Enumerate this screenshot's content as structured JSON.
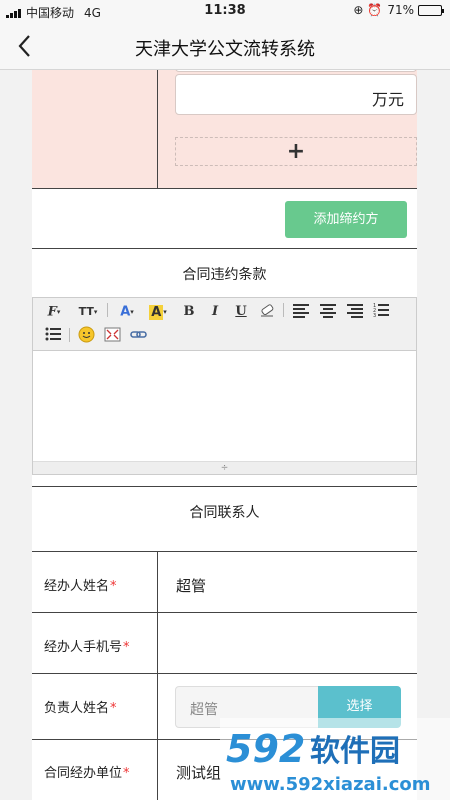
{
  "status_bar": {
    "carrier": "中国移动",
    "network": "4G",
    "time": "11:38",
    "battery": "71%",
    "battery_level": 0.71
  },
  "nav": {
    "title": "天津大学公文流转系统"
  },
  "party": {
    "amount_unit": "万元",
    "add_symbol": "+"
  },
  "add_party_button": "添加缔约方",
  "breach_section": {
    "title": "合同违约条款"
  },
  "editor_toolbar": {
    "font_family": "F",
    "font_size": "TT",
    "font_color": "A",
    "bg_color": "A",
    "bold": "B",
    "italic": "I",
    "underline": "U",
    "resize_handle": "÷"
  },
  "contact_section": {
    "title": "合同联系人",
    "rows": [
      {
        "label": "经办人姓名",
        "required": "*",
        "value": "超管"
      },
      {
        "label": "经办人手机号",
        "required": "*",
        "value": ""
      },
      {
        "label": "负责人姓名",
        "required": "*",
        "input_value": "超管",
        "button": "选择"
      },
      {
        "label": "合同经办单位",
        "required": "*",
        "value": "测试组"
      }
    ]
  },
  "watermark": {
    "number": "592",
    "brand": "软件园",
    "domain": "www.592xiazai.com"
  }
}
